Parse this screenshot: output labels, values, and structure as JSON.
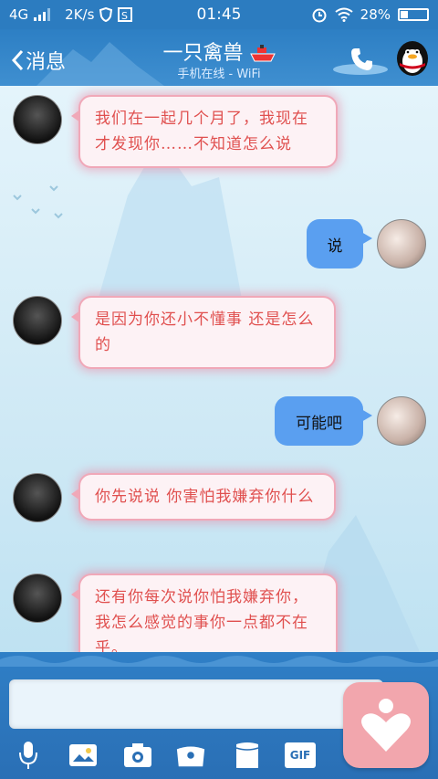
{
  "status_bar": {
    "network": "4G",
    "speed": "2K/s",
    "time": "01:45",
    "battery": "28%"
  },
  "header": {
    "back_label": "消息",
    "contact_name": "一只禽兽",
    "subtitle": "手机在线 - WiFi"
  },
  "messages": [
    {
      "side": "in",
      "text": "我们在一起几个月了，我现在才发现你……不知道怎么说"
    },
    {
      "side": "out",
      "text": "说"
    },
    {
      "side": "in",
      "text": "是因为你还小不懂事  还是怎么的"
    },
    {
      "side": "out",
      "text": "可能吧"
    },
    {
      "side": "in",
      "text": "你先说说  你害怕我嫌弃你什么"
    },
    {
      "side": "in",
      "text": "还有你每次说你怕我嫌弃你，我怎么感觉的事你一点都不在乎。"
    }
  ],
  "input": {
    "placeholder": ""
  },
  "toolbar": {
    "icons": [
      "microphone-icon",
      "photo-icon",
      "camera-icon",
      "hongbao-icon",
      "emoji-icon",
      "gif-icon"
    ],
    "gif_label": "GIF"
  },
  "colors": {
    "header": "#2d7fc4",
    "bubble_in_text": "#e0504f",
    "bubble_in_border": "#f0a8b8",
    "bubble_out": "#5a9ff0",
    "heart_button": "#f2a6ad"
  }
}
